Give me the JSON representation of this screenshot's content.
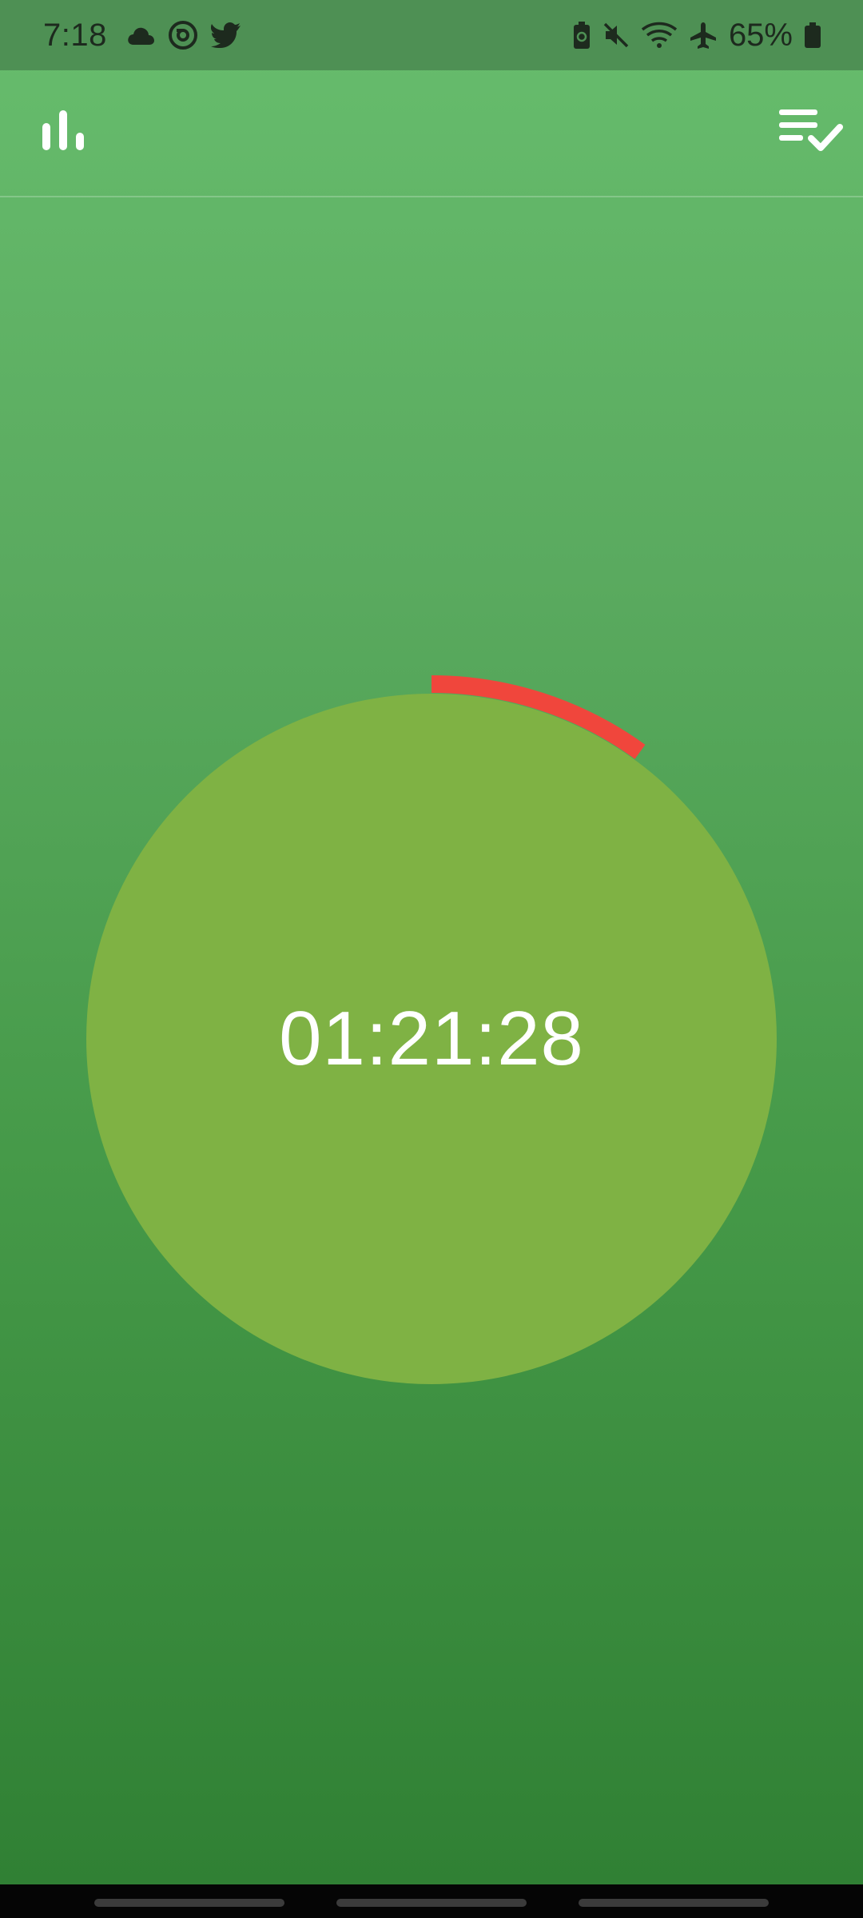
{
  "status_bar": {
    "time": "7:18",
    "battery_percent": "65%",
    "left_icons": [
      "cloud-icon",
      "sync-badge-icon",
      "twitter-bird-icon"
    ],
    "right_icons": [
      "battery-saver-icon",
      "mute-icon",
      "wifi-icon",
      "airplane-icon",
      "battery-icon"
    ]
  },
  "toolbar": {
    "left_icon": "bar-chart-icon",
    "right_icon": "checklist-icon"
  },
  "timer": {
    "display": "01:21:28",
    "progress_fraction": 0.1,
    "progress_color": "#f0463c",
    "circle_color": "#7fb244"
  },
  "colors": {
    "background_top": "#67bd6d",
    "background_bottom": "#2f7f33",
    "status_bar": "#4e9054"
  }
}
